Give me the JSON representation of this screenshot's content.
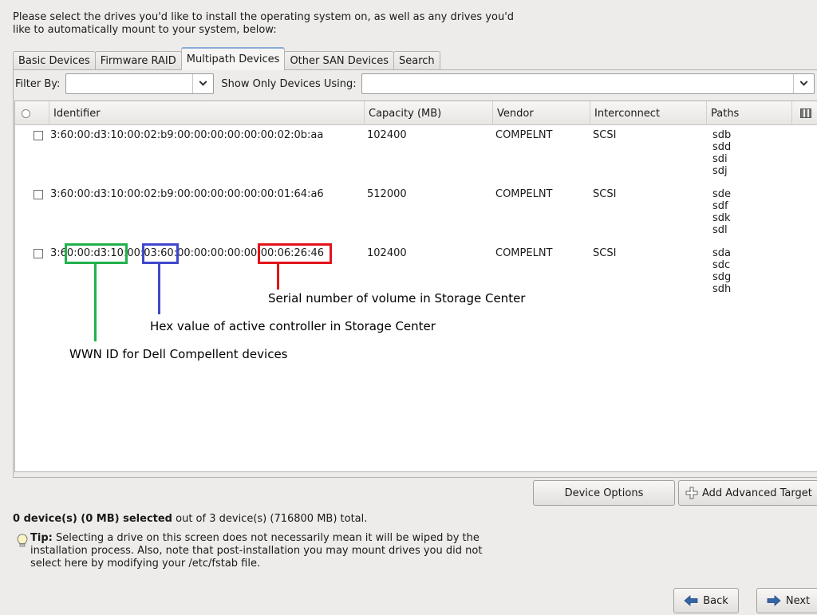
{
  "intro": "Please select the drives you'd like to install the operating system on, as well as any drives you'd like to automatically mount to your system, below:",
  "tabs": [
    {
      "label": "Basic Devices",
      "active": false
    },
    {
      "label": "Firmware RAID",
      "active": false
    },
    {
      "label": "Multipath Devices",
      "active": true
    },
    {
      "label": "Other SAN Devices",
      "active": false
    },
    {
      "label": "Search",
      "active": false
    }
  ],
  "filter": {
    "filter_by_label": "Filter By:",
    "filter_by_value": "",
    "show_only_label": "Show Only Devices Using:",
    "show_only_value": ""
  },
  "table": {
    "columns": [
      "Identifier",
      "Capacity (MB)",
      "Vendor",
      "Interconnect",
      "Paths"
    ],
    "rows": [
      {
        "checked": false,
        "identifier": "3:60:00:d3:10:00:02:b9:00:00:00:00:00:00:02:0b:aa",
        "capacity": "102400",
        "vendor": "COMPELNT",
        "interconnect": "SCSI",
        "paths": [
          "sdb",
          "sdd",
          "sdi",
          "sdj"
        ]
      },
      {
        "checked": false,
        "identifier": "3:60:00:d3:10:00:02:b9:00:00:00:00:00:00:01:64:a6",
        "capacity": "512000",
        "vendor": "COMPELNT",
        "interconnect": "SCSI",
        "paths": [
          "sde",
          "sdf",
          "sdk",
          "sdl"
        ]
      },
      {
        "checked": false,
        "identifier": "3:60:00:d3:10:00:03:60:00:00:00:00:00:00:06:26:46",
        "capacity": "102400",
        "vendor": "COMPELNT",
        "interconnect": "SCSI",
        "paths": [
          "sda",
          "sdc",
          "sdg",
          "sdh"
        ]
      }
    ]
  },
  "annotations": {
    "serial": "Serial number of volume in Storage Center",
    "hex": "Hex value of active controller in Storage Center",
    "wwn": "WWN ID for Dell Compellent devices",
    "colors": {
      "wwn": "#22b14c",
      "hex": "#3f48cc",
      "serial": "#e3141c"
    }
  },
  "buttons": {
    "device_options": "Device Options",
    "add_advanced_target": "Add Advanced Target",
    "back": "Back",
    "next": "Next"
  },
  "status": {
    "selected": "0 device(s) (0 MB) selected",
    "rest": " out of 3 device(s) (716800 MB) total."
  },
  "tip": {
    "label": "Tip:",
    "text": " Selecting a drive on this screen does not necessarily mean it will be wiped by the installation process.  Also, note that post-installation you may mount drives you did not select here by modifying your /etc/fstab file."
  },
  "icons": {
    "add_target": "plus-icon",
    "back": "arrow-left-icon",
    "next": "arrow-right-icon",
    "tip": "lightbulb-icon",
    "column_chooser": "columns-icon"
  }
}
